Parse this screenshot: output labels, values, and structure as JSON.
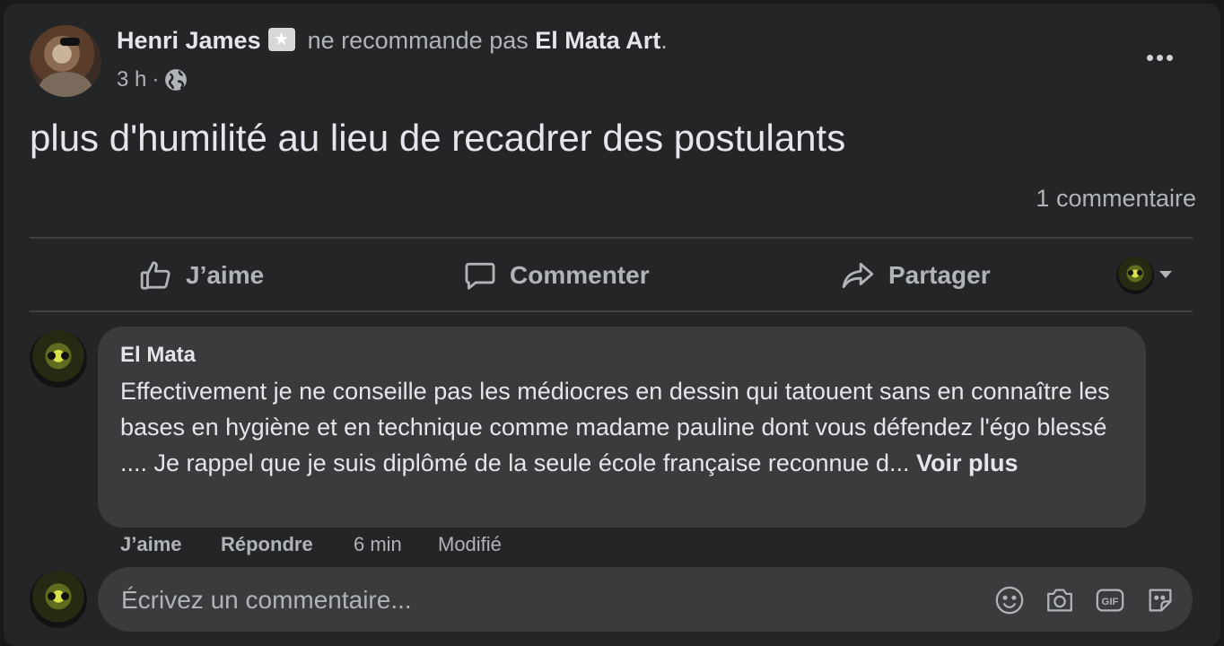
{
  "post": {
    "author": "Henri James",
    "verb": "ne recommande pas",
    "page": "El Mata Art",
    "period": ".",
    "time": "3 h",
    "dot": "·",
    "text": "plus d'humilité au lieu de recadrer des postulants",
    "comment_count": "1 commentaire"
  },
  "actions": {
    "like": "J’aime",
    "comment": "Commenter",
    "share": "Partager"
  },
  "comment": {
    "author": "El Mata",
    "text": "Effectivement je ne conseille pas les médiocres en dessin qui tatouent sans en connaître les bases en hygiène et en technique comme madame pauline dont vous défendez l'égo blessé .... Je rappel que je suis diplômé de la seule école française reconnue d...",
    "see_more": "Voir plus",
    "like": "J’aime",
    "reply": "Répondre",
    "time": "6 min",
    "edited": "Modifié"
  },
  "composer": {
    "placeholder": "Écrivez un commentaire..."
  },
  "icons": {
    "badge": "star-badge-icon",
    "privacy": "globe-icon",
    "more": "more-icon",
    "like": "thumbs-up-icon",
    "comment": "comment-bubble-icon",
    "share": "share-arrow-icon",
    "emoji": "emoji-icon",
    "camera": "camera-icon",
    "gif": "gif-icon",
    "sticker": "sticker-icon"
  }
}
